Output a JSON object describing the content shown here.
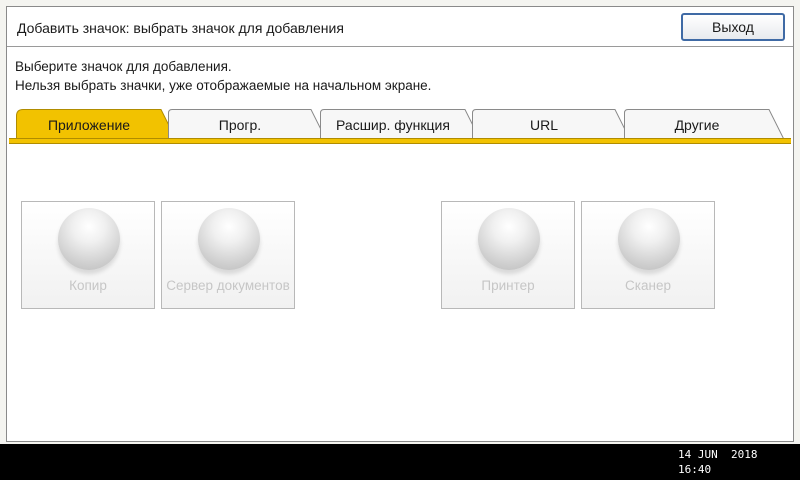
{
  "window": {
    "title": "Добавить значок: выбрать значок для добавления",
    "exit_label": "Выход"
  },
  "instructions": {
    "line1": "Выберите значок для добавления.",
    "line2": "Нельзя выбрать значки, уже отображаемые на начальном экране."
  },
  "tabs": [
    {
      "label": "Приложение",
      "active": true
    },
    {
      "label": "Прогр.",
      "active": false
    },
    {
      "label": "Расшир. функция",
      "active": false
    },
    {
      "label": "URL",
      "active": false
    },
    {
      "label": "Другие",
      "active": false
    }
  ],
  "apps": [
    {
      "label": "Копир",
      "icon": "copier-icon",
      "enabled": false
    },
    {
      "label": "Сервер документов",
      "icon": "document-server-icon",
      "enabled": false
    },
    {
      "label": "Принтер",
      "icon": "printer-icon",
      "enabled": false
    },
    {
      "label": "Сканер",
      "icon": "scanner-icon",
      "enabled": false
    }
  ],
  "status": {
    "date": "14 JUN  2018",
    "time": "16:40"
  },
  "colors": {
    "accent": "#f2c200",
    "exit_border": "#3f6aa5",
    "disabled_text": "#c6c6c6"
  }
}
